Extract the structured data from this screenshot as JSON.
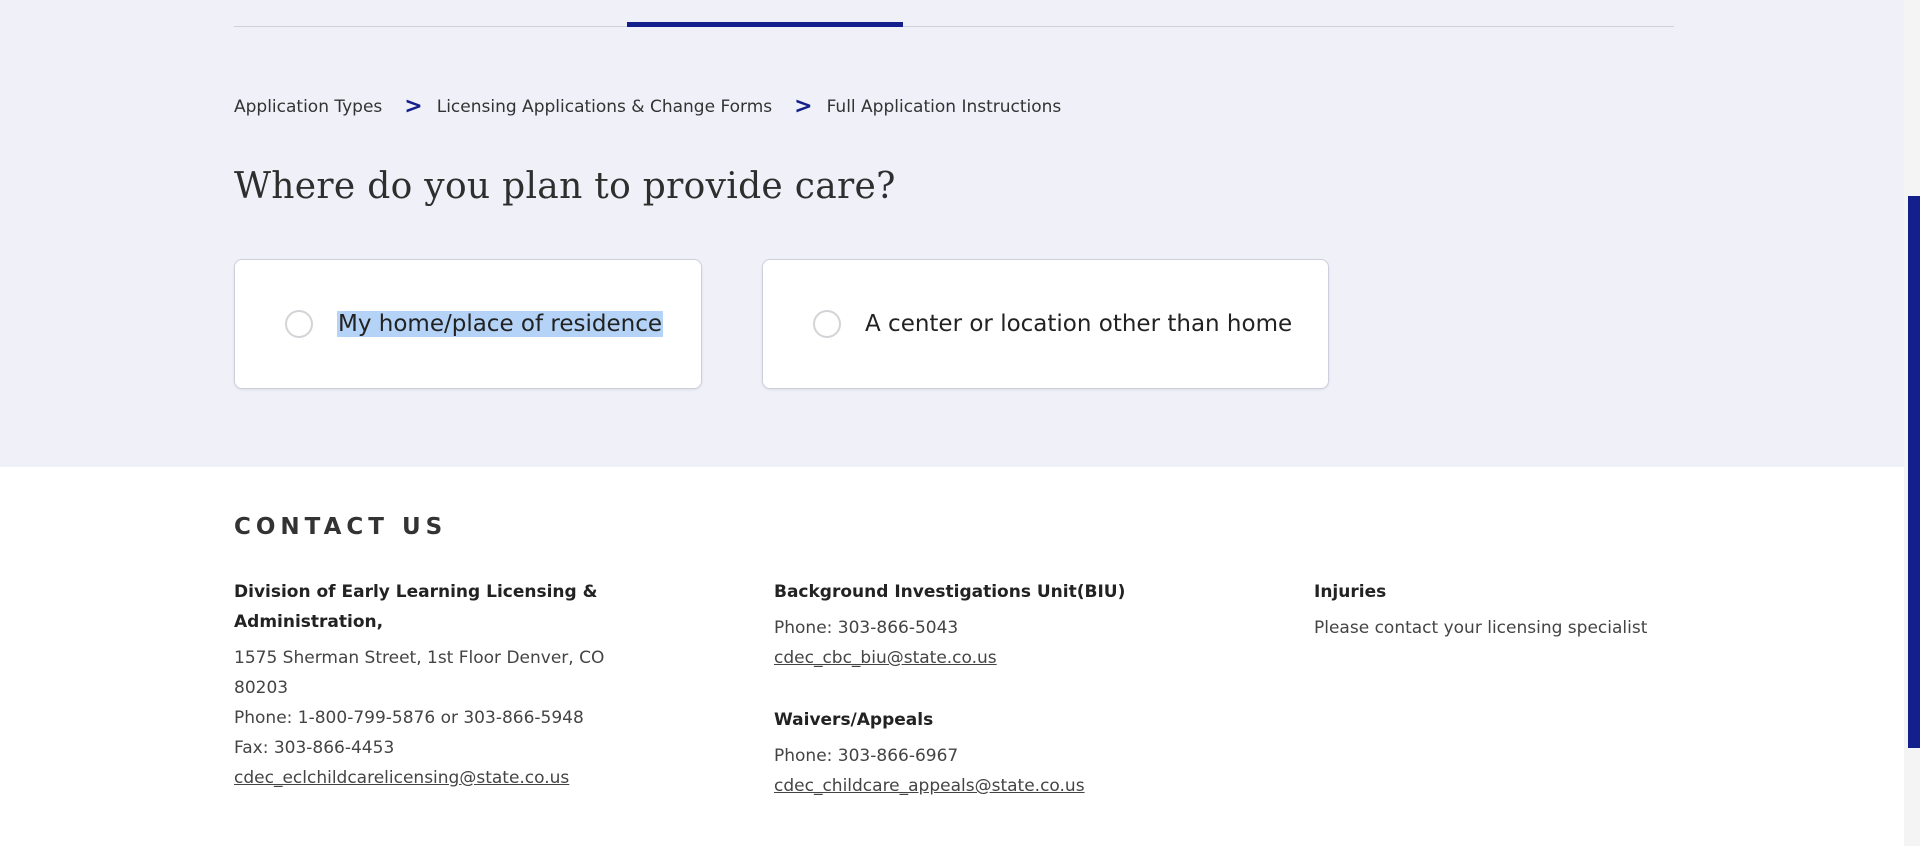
{
  "breadcrumb": {
    "items": [
      "Application Types",
      "Licensing Applications & Change Forms",
      "Full Application Instructions"
    ],
    "separator": ">"
  },
  "question": {
    "title": "Where do you plan to provide care?",
    "options": [
      "My home/place of residence",
      "A center or location other than home"
    ]
  },
  "contact": {
    "heading": "CONTACT US",
    "division": {
      "title": "Division of Early Learning Licensing & Administration,",
      "address": "1575 Sherman Street, 1st Floor Denver, CO 80203",
      "phone": "Phone: 1-800-799-5876 or 303-866-5948",
      "fax": "Fax: 303-866-4453",
      "email": "cdec_eclchildcarelicensing@state.co.us"
    },
    "biu": {
      "title": "Background Investigations Unit(BIU)",
      "phone": "Phone: 303-866-5043",
      "email": "cdec_cbc_biu@state.co.us"
    },
    "waivers": {
      "title": "Waivers/Appeals",
      "phone": "Phone: 303-866-6967",
      "email": "cdec_childcare_appeals@state.co.us"
    },
    "injuries": {
      "title": "Injuries",
      "text": "Please contact your licensing specialist"
    }
  },
  "colors": {
    "accent": "#131f8c",
    "section_bg": "#eff0f8",
    "selection": "#b4d3f7"
  }
}
